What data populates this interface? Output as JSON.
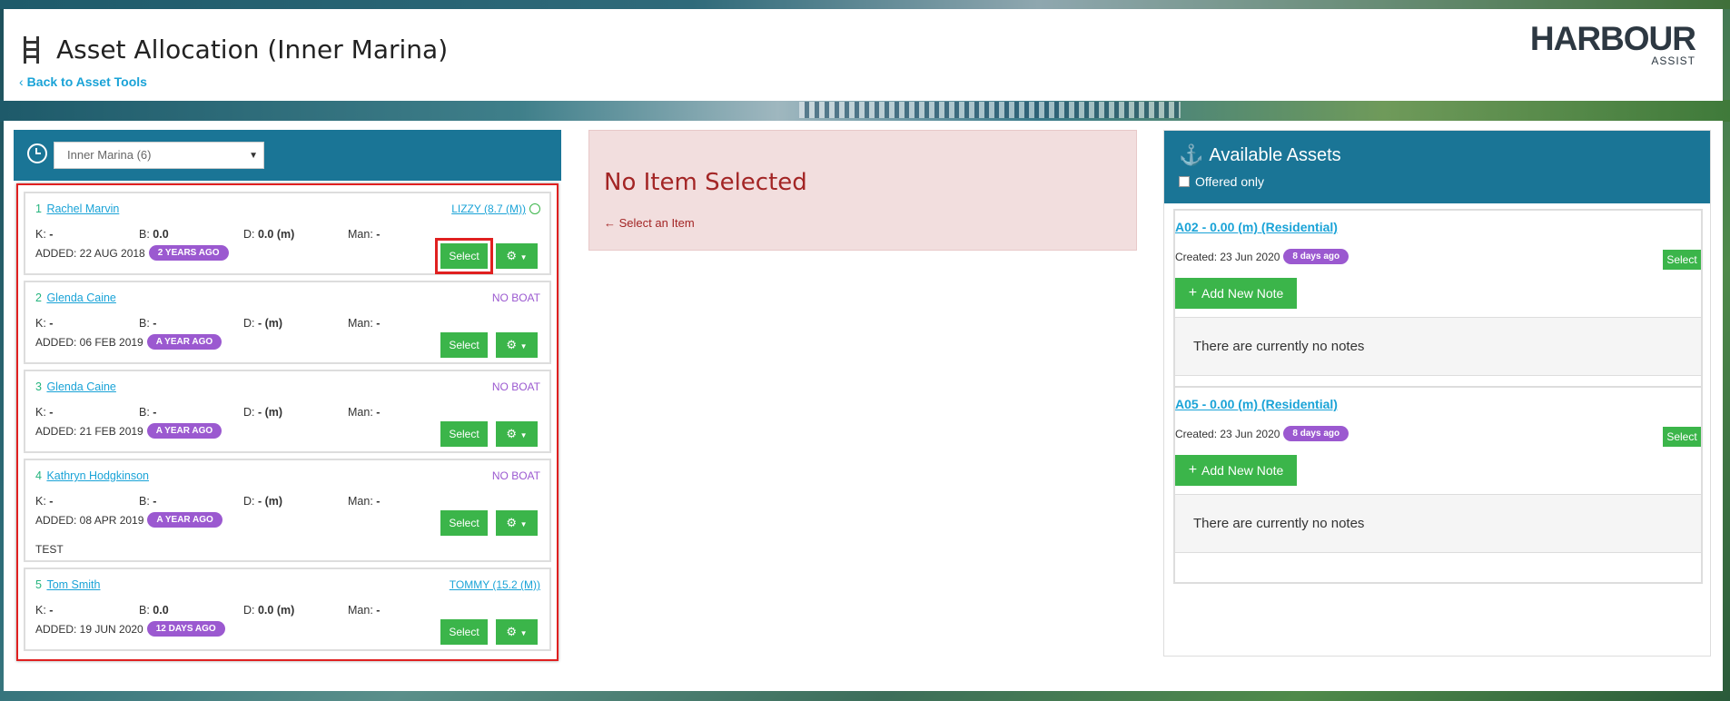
{
  "header": {
    "title": "Asset Allocation (Inner Marina)",
    "back_link": "Back to Asset Tools",
    "logo_brand": "HARBOUR",
    "logo_sub": "ASSIST"
  },
  "left": {
    "select_value": "Inner Marina (6)",
    "stat_labels": {
      "k": "K:",
      "b": "B:",
      "d": "D:",
      "man": "Man:"
    },
    "select_label": "Select",
    "items": [
      {
        "num": "1",
        "name": "Rachel Marvin",
        "boat": "LIZZY (8.7 (M))",
        "k": "-",
        "b": "0.0",
        "d": "0.0 (m)",
        "man": "-",
        "added": "ADDED: 22 AUG 2018",
        "badge": "2 YEARS AGO",
        "note": ""
      },
      {
        "num": "2",
        "name": "Glenda Caine",
        "boat": "NO BOAT",
        "k": "-",
        "b": "-",
        "d": "- (m)",
        "man": "-",
        "added": "ADDED: 06 FEB 2019",
        "badge": "A YEAR AGO",
        "note": ""
      },
      {
        "num": "3",
        "name": "Glenda Caine",
        "boat": "NO BOAT",
        "k": "-",
        "b": "-",
        "d": "- (m)",
        "man": "-",
        "added": "ADDED: 21 FEB 2019",
        "badge": "A YEAR AGO",
        "note": ""
      },
      {
        "num": "4",
        "name": "Kathryn Hodgkinson",
        "boat": "NO BOAT",
        "k": "-",
        "b": "-",
        "d": "- (m)",
        "man": "-",
        "added": "ADDED: 08 APR 2019",
        "badge": "A YEAR AGO",
        "note": "TEST"
      },
      {
        "num": "5",
        "name": "Tom Smith",
        "boat": "TOMMY (15.2 (M))",
        "k": "-",
        "b": "0.0",
        "d": "0.0 (m)",
        "man": "-",
        "added": "ADDED: 19 JUN 2020",
        "badge": "12 DAYS AGO",
        "note": ""
      }
    ]
  },
  "middle": {
    "title": "No Item Selected",
    "hint": "Select an Item"
  },
  "right": {
    "title": "Available Assets",
    "offered_only": "Offered only",
    "assets": [
      {
        "title": "A02 - 0.00 (m) (Residential)",
        "created": "Created: 23 Jun 2020",
        "badge": "8 days ago",
        "select": "Select",
        "add_note": "Add New Note",
        "notes_text": "There are currently no notes"
      },
      {
        "title": "A05 - 0.00 (m) (Residential)",
        "created": "Created: 23 Jun 2020",
        "badge": "8 days ago",
        "select": "Select",
        "add_note": "Add New Note",
        "notes_text": "There are currently no notes"
      }
    ]
  },
  "colors": {
    "accent_teal": "#1a7596",
    "green": "#3bb54a",
    "purple": "#9b59d0",
    "link_blue": "#1aa3d7",
    "danger_bg": "#f2dede",
    "danger_text": "#a32525",
    "highlight_red": "#e02020"
  }
}
